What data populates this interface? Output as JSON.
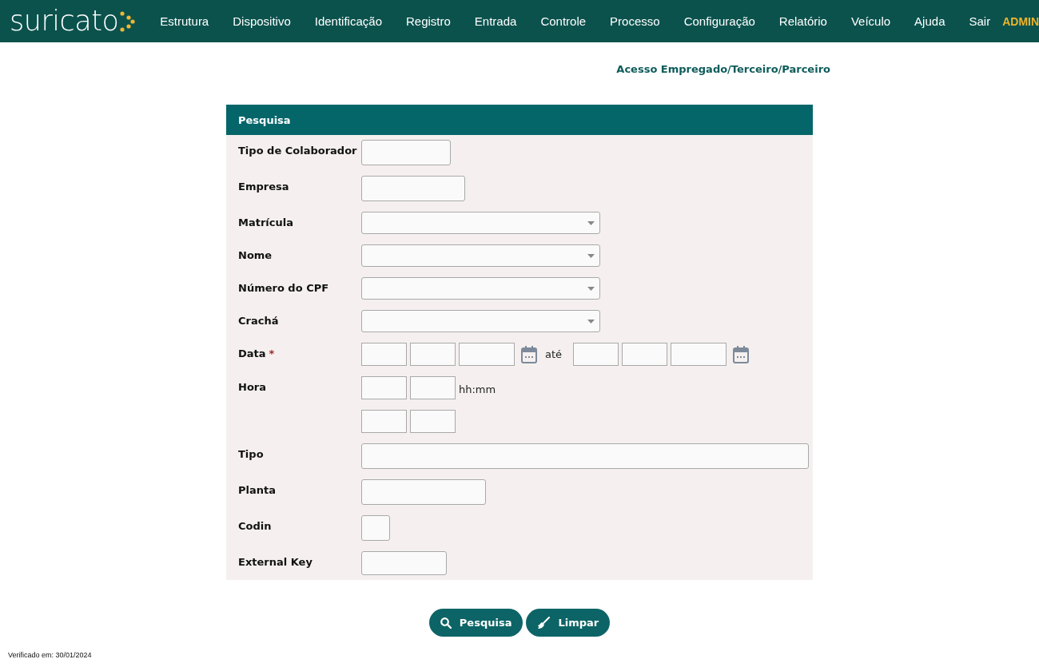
{
  "nav": {
    "logo": "suricato",
    "items": [
      {
        "label": "Estrutura"
      },
      {
        "label": "Dispositivo"
      },
      {
        "label": "Identificação"
      },
      {
        "label": "Registro"
      },
      {
        "label": "Entrada"
      },
      {
        "label": "Controle"
      },
      {
        "label": "Processo"
      },
      {
        "label": "Configuração"
      },
      {
        "label": "Relatório"
      },
      {
        "label": "Veículo"
      },
      {
        "label": "Ajuda"
      },
      {
        "label": "Sair"
      }
    ],
    "user": "ADMIN"
  },
  "page_title": "Acesso Empregado/Terceiro/Parceiro",
  "panel": {
    "title": "Pesquisa",
    "fields": [
      {
        "label": "Tipo de Colaborador",
        "kind": "text"
      },
      {
        "label": "Empresa",
        "kind": "text"
      },
      {
        "label": "Matrícula",
        "kind": "select"
      },
      {
        "label": "Nome",
        "kind": "select"
      },
      {
        "label": "Número do CPF",
        "kind": "select"
      },
      {
        "label": "Crachá",
        "kind": "select"
      },
      {
        "label": "Data",
        "required_mark": "*",
        "kind": "daterange",
        "separator": "até"
      },
      {
        "label": "Hora",
        "kind": "time",
        "suffix": "hh:mm"
      },
      {
        "kind": "time"
      },
      {
        "label": "Tipo",
        "kind": "text"
      },
      {
        "label": "Planta",
        "kind": "text"
      },
      {
        "label": "Codin",
        "kind": "text"
      },
      {
        "label": "External Key",
        "kind": "text"
      }
    ]
  },
  "buttons": [
    {
      "label": "Pesquisa",
      "kind": "search"
    },
    {
      "label": "Limpar",
      "kind": "clear"
    }
  ],
  "footer": "Verificado em: 30/01/2024"
}
